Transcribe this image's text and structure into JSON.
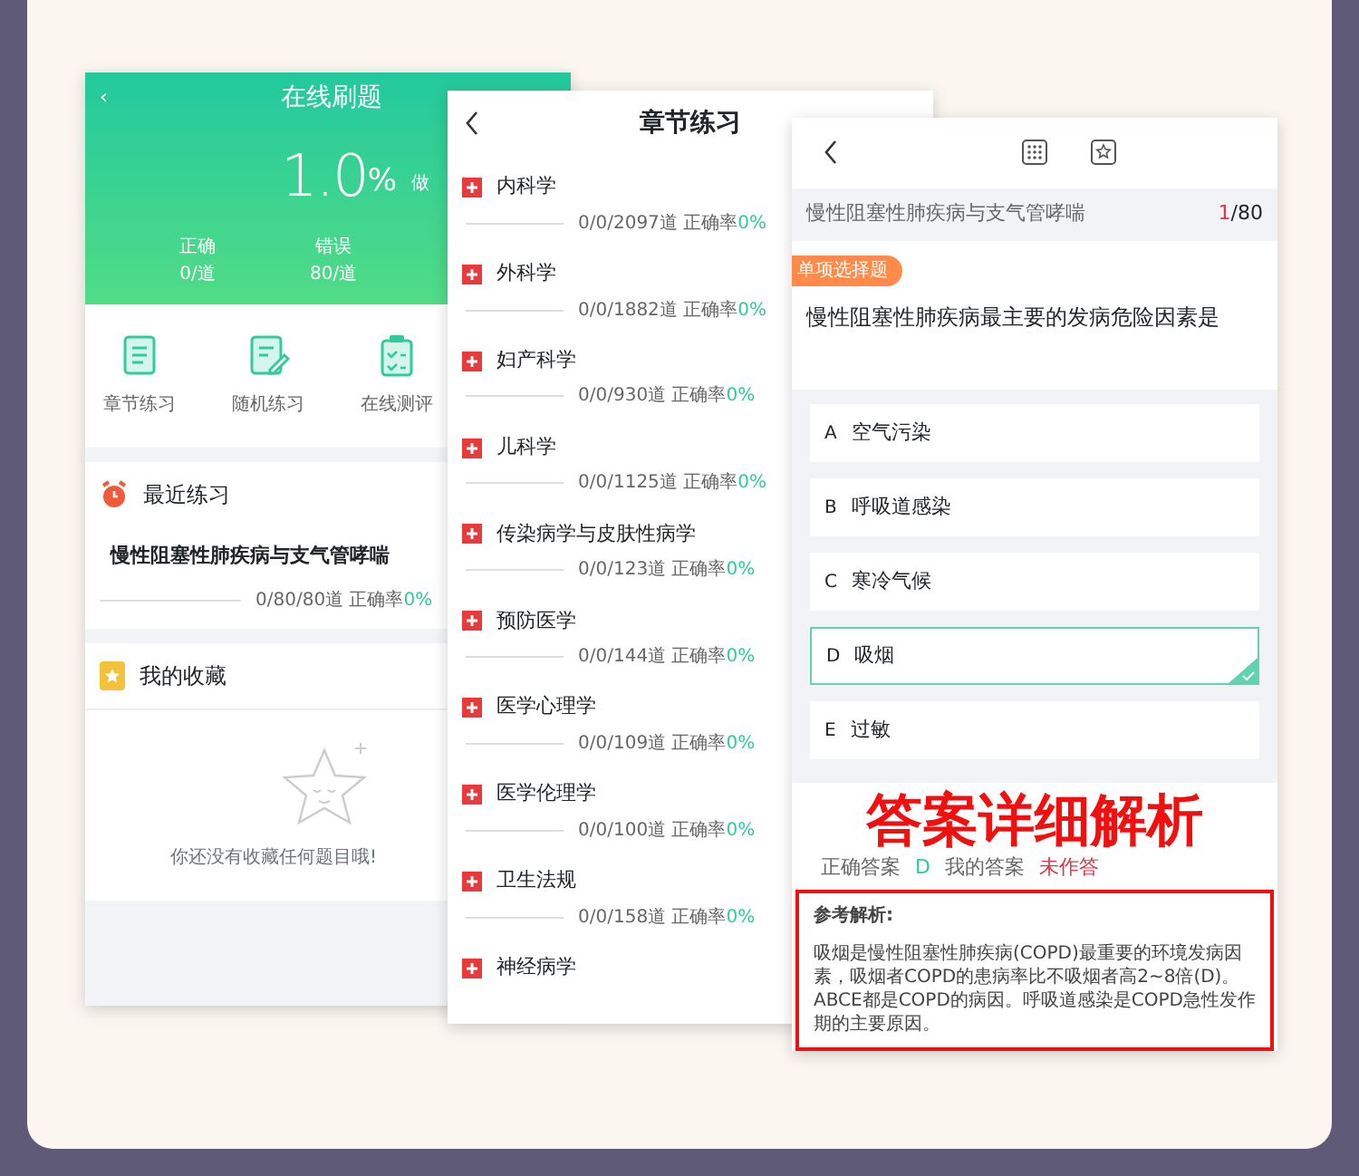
{
  "home_screen": {
    "title": "在线刷题",
    "back": "‹",
    "rate_value": "1.0",
    "rate_unit": "%",
    "rate_label": "做",
    "stats": [
      {
        "label": "正确",
        "value": "0/道"
      },
      {
        "label": "错误",
        "value": "80/道"
      }
    ],
    "shortcuts": [
      {
        "kind": "scroll",
        "label": "章节练习"
      },
      {
        "kind": "edit",
        "label": "随机练习"
      },
      {
        "kind": "clipboard",
        "label": "在线测评"
      }
    ],
    "recent": {
      "title": "最近练习",
      "item": {
        "name": "慢性阻塞性肺疾病与支气管哮喘",
        "count": "0/80/80道",
        "rate_label": "正确率",
        "rate": "0%",
        "level": 0
      }
    },
    "favorites": {
      "title": "我的收藏",
      "empty_text": "你还没有收藏任何题目哦!"
    }
  },
  "chapter_screen": {
    "title": "章节练习",
    "chapters": [
      {
        "name": "内科学",
        "count": "0/0/2097道",
        "rate_label": "正确率",
        "rate": "0%"
      },
      {
        "name": "外科学",
        "count": "0/0/1882道",
        "rate_label": "正确率",
        "rate": "0%"
      },
      {
        "name": "妇产科学",
        "count": "0/0/930道",
        "rate_label": "正确率",
        "rate": "0%"
      },
      {
        "name": "儿科学",
        "count": "0/0/1125道",
        "rate_label": "正确率",
        "rate": "0%"
      },
      {
        "name": "传染病学与皮肤性病学",
        "count": "0/0/123道",
        "rate_label": "正确率",
        "rate": "0%"
      },
      {
        "name": "预防医学",
        "count": "0/0/144道",
        "rate_label": "正确率",
        "rate": "0%"
      },
      {
        "name": "医学心理学",
        "count": "0/0/109道",
        "rate_label": "正确率",
        "rate": "0%"
      },
      {
        "name": "医学伦理学",
        "count": "0/0/100道",
        "rate_label": "正确率",
        "rate": "0%"
      },
      {
        "name": "卫生法规",
        "count": "0/0/158道",
        "rate_label": "正确率",
        "rate": "0%"
      },
      {
        "name": "神经病学"
      }
    ]
  },
  "question_screen": {
    "chapter": "慢性阻塞性肺疾病与支气管哮喘",
    "current": "1",
    "total": "/80",
    "tag": "单项选择题",
    "question": "慢性阻塞性肺疾病最主要的发病危险因素是",
    "options": [
      {
        "letter": "A",
        "text": "空气污染",
        "selected": false
      },
      {
        "letter": "B",
        "text": "呼吸道感染",
        "selected": false
      },
      {
        "letter": "C",
        "text": "寒冷气候",
        "selected": false
      },
      {
        "letter": "D",
        "text": "吸烟",
        "selected": true
      },
      {
        "letter": "E",
        "text": "过敏",
        "selected": false
      }
    ],
    "banner": "答案详细解析",
    "answer": {
      "correct_label": "正确答案",
      "correct": "D",
      "mine_label": "我的答案",
      "mine": "未作答"
    },
    "analysis": {
      "title": "参考解析:",
      "text": "吸烟是慢性阻塞性肺疾病(COPD)最重要的环境发病因素，吸烟者COPD的患病率比不吸烟者高2~8倍(D)。ABCE都是COPD的病因。呼吸道感染是COPD急性发作期的主要原因。"
    }
  }
}
